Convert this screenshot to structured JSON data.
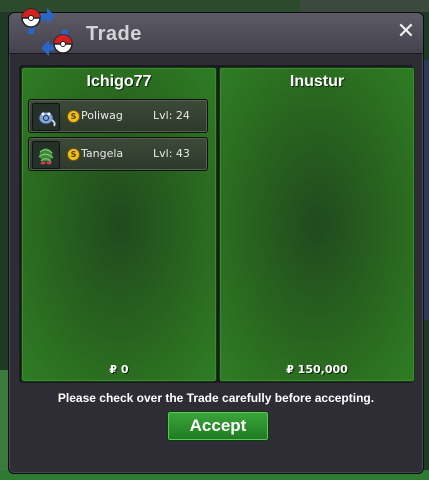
{
  "window": {
    "title": "Trade",
    "close_glyph": "✕",
    "icon": "trade-pokeballs-icon"
  },
  "left_panel": {
    "trainer_name": "Ichigo77",
    "money": "₽ 0",
    "items": [
      {
        "badge": "S",
        "name": "Poliwag",
        "level": "Lvl: 24",
        "sprite_icon": "poliwag-sprite-icon"
      },
      {
        "badge": "S",
        "name": "Tangela",
        "level": "Lvl: 43",
        "sprite_icon": "tangela-sprite-icon"
      }
    ]
  },
  "right_panel": {
    "trainer_name": "Inustur",
    "money": "₽ 150,000",
    "items": []
  },
  "notice": "Please check over the Trade carefully before accepting.",
  "accept_label": "Accept",
  "colors": {
    "panel_green": "#2f7d24",
    "accept_green": "#2a8f2c",
    "badge_gold": "#f0c020"
  }
}
